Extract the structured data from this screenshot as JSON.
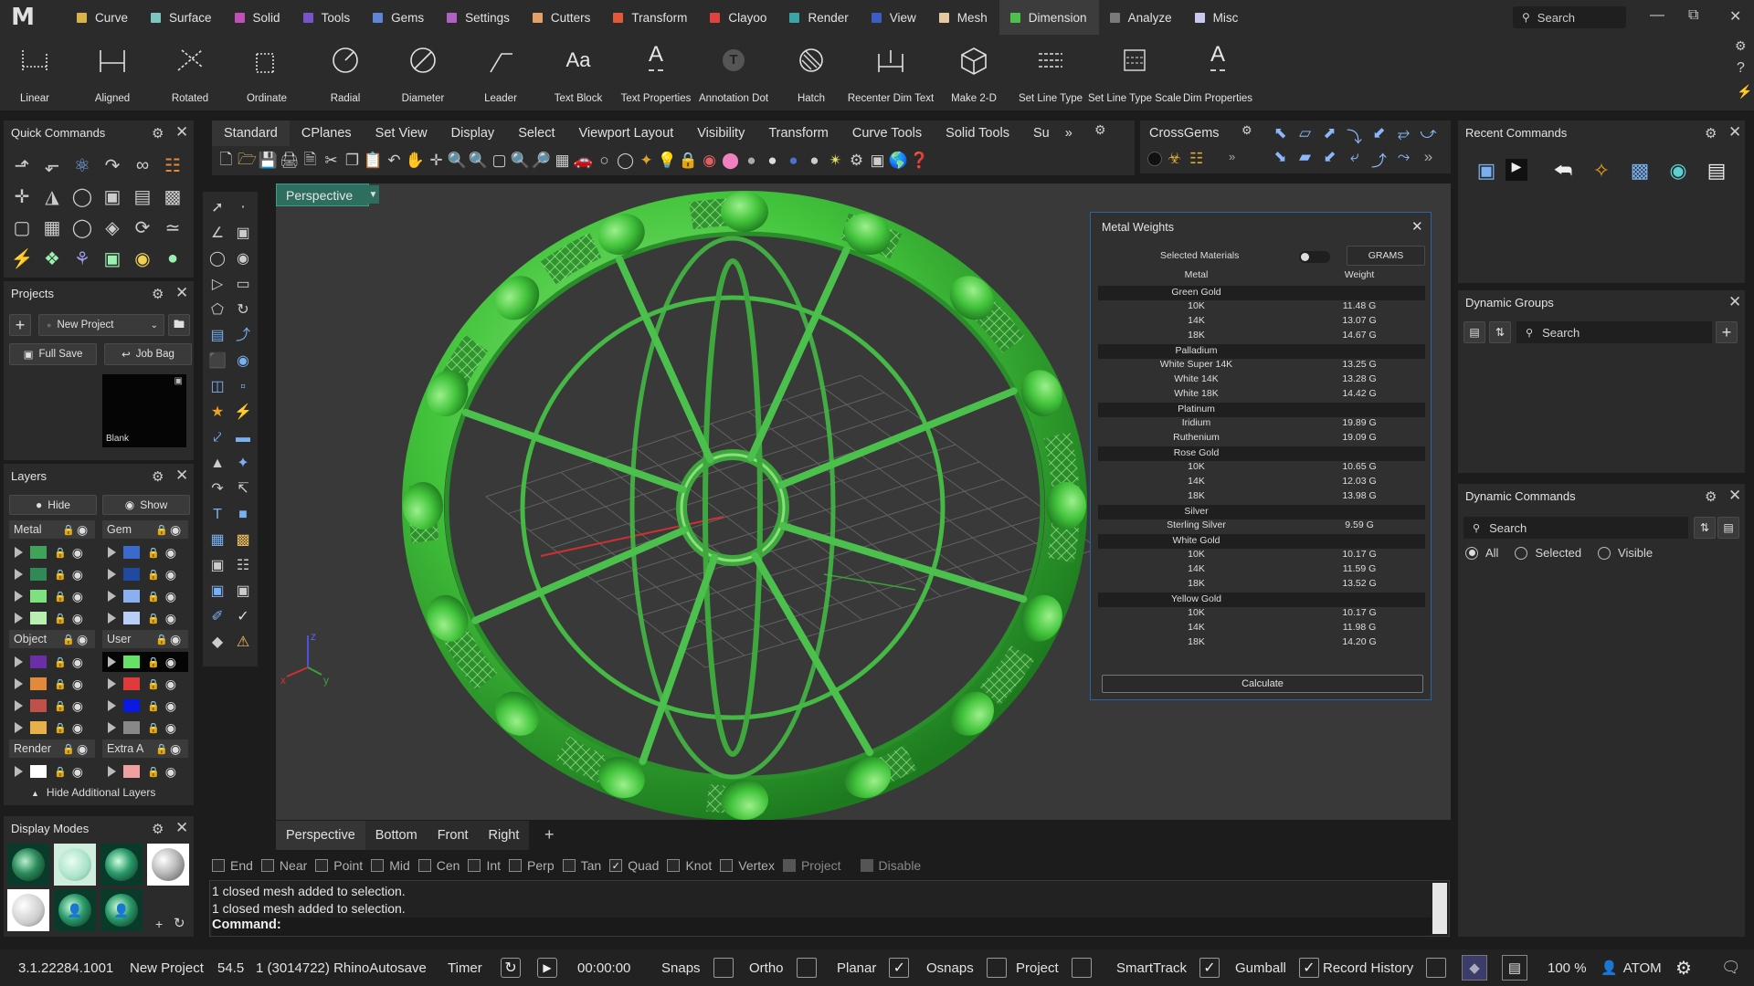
{
  "app": {
    "logo": "M"
  },
  "menu": [
    {
      "label": "Curve",
      "color": "#d9b24a"
    },
    {
      "label": "Surface",
      "color": "#7ec4c0"
    },
    {
      "label": "Solid",
      "color": "#c24fb8"
    },
    {
      "label": "Tools",
      "color": "#7a52c9"
    },
    {
      "label": "Gems",
      "color": "#5f86d6"
    },
    {
      "label": "Settings",
      "color": "#b160c4"
    },
    {
      "label": "Cutters",
      "color": "#e2a06a"
    },
    {
      "label": "Transform",
      "color": "#e05a3a"
    },
    {
      "label": "Clayoo",
      "color": "#e04141"
    },
    {
      "label": "Render",
      "color": "#3aa5a5"
    },
    {
      "label": "View",
      "color": "#3d5cc4"
    },
    {
      "label": "Mesh",
      "color": "#e6c9a0"
    },
    {
      "label": "Dimension",
      "color": "#4ec04e",
      "active": true
    },
    {
      "label": "Analyze",
      "color": "#7a7a7a"
    },
    {
      "label": "Misc",
      "color": "#c9c9f0"
    }
  ],
  "search_top": "Search",
  "ribbon": [
    {
      "label": "Linear",
      "icon": "linear-dim-icon"
    },
    {
      "label": "Aligned",
      "icon": "aligned-dim-icon"
    },
    {
      "label": "Rotated",
      "icon": "rotated-dim-icon"
    },
    {
      "label": "Ordinate",
      "icon": "ordinate-dim-icon"
    },
    {
      "label": "Radial",
      "icon": "radial-dim-icon"
    },
    {
      "label": "Diameter",
      "icon": "diameter-dim-icon"
    },
    {
      "label": "Leader",
      "icon": "leader-icon"
    },
    {
      "label": "Text Block",
      "icon": "text-block-icon",
      "glyph": "Aa"
    },
    {
      "label": "Text Properties",
      "icon": "text-properties-icon",
      "glyph": "A"
    },
    {
      "label": "Annotation Dot",
      "icon": "annotation-dot-icon",
      "glyph": "T"
    },
    {
      "label": "Hatch",
      "icon": "hatch-icon"
    },
    {
      "label": "Recenter Dim Text",
      "icon": "recenter-dim-text-icon"
    },
    {
      "label": "Make 2-D",
      "icon": "make-2d-icon"
    },
    {
      "label": "Set Line Type",
      "icon": "set-line-type-icon"
    },
    {
      "label": "Set Line Type Scale",
      "icon": "set-line-type-scale-icon"
    },
    {
      "label": "Dim Properties",
      "icon": "dim-properties-icon",
      "glyph": "A"
    }
  ],
  "quick_commands": {
    "title": "Quick Commands"
  },
  "projects": {
    "title": "Projects",
    "dropdown": "New Project",
    "full_save": "Full Save",
    "job_bag": "Job Bag",
    "thumb_label": "Blank"
  },
  "layers": {
    "title": "Layers",
    "hide": "Hide",
    "show": "Show",
    "groups_left": [
      {
        "name": "Metal",
        "colors": [
          "#3fa35a",
          "#2f8a55",
          "#7fe07f",
          "#b9f0b0"
        ]
      },
      {
        "name": "Object",
        "colors": [
          "#6a2fa8",
          "#e38a3a",
          "#c0504a",
          "#e8b04a"
        ]
      },
      {
        "name": "Render",
        "colors": [
          "#ffffff"
        ]
      }
    ],
    "groups_right": [
      {
        "name": "Gem",
        "colors": [
          "#3a6acc",
          "#1f4aa0",
          "#8ab0f0",
          "#b8d0f8"
        ]
      },
      {
        "name": "User",
        "colors": [
          "#66e066",
          "#e03a3a",
          "#0a1ae0",
          "#888888"
        ]
      },
      {
        "name": "Extra A",
        "colors": [
          "#f0a0a0"
        ]
      }
    ],
    "hide_additional": "Hide Additional Layers"
  },
  "display_modes": {
    "title": "Display Modes"
  },
  "toolbar_tabs": [
    "Standard",
    "CPlanes",
    "Set View",
    "Display",
    "Select",
    "Viewport Layout",
    "Visibility",
    "Transform",
    "Curve Tools",
    "Solid Tools",
    "Su"
  ],
  "crossgems_tab": "CrossGems",
  "viewport": {
    "label": "Perspective"
  },
  "viewport_tabs": [
    "Perspective",
    "Bottom",
    "Front",
    "Right"
  ],
  "metal_weights": {
    "title": "Metal Weights",
    "selected_materials": "Selected Materials",
    "unit_button": "GRAMS",
    "col_metal": "Metal",
    "col_weight": "Weight",
    "groups": [
      {
        "name": "Green Gold",
        "rows": [
          [
            "10K",
            "11.48 G"
          ],
          [
            "14K",
            "13.07 G"
          ],
          [
            "18K",
            "14.67 G"
          ]
        ]
      },
      {
        "name": "Palladium",
        "rows": [
          [
            "White Super 14K",
            "13.25 G"
          ],
          [
            "White 14K",
            "13.28 G"
          ],
          [
            "White 18K",
            "14.42 G"
          ]
        ]
      },
      {
        "name": "Platinum",
        "rows": [
          [
            "Iridium",
            "19.89 G"
          ],
          [
            "Ruthenium",
            "19.09 G"
          ]
        ]
      },
      {
        "name": "Rose Gold",
        "rows": [
          [
            "10K",
            "10.65 G"
          ],
          [
            "14K",
            "12.03 G"
          ],
          [
            "18K",
            "13.98 G"
          ]
        ]
      },
      {
        "name": "Silver",
        "rows": [
          [
            "Sterling Silver",
            "9.59 G"
          ]
        ]
      },
      {
        "name": "White Gold",
        "rows": [
          [
            "10K",
            "10.17 G"
          ],
          [
            "14K",
            "11.59 G"
          ],
          [
            "18K",
            "13.52 G"
          ]
        ]
      },
      {
        "name": "Yellow Gold",
        "rows": [
          [
            "10K",
            "10.17 G"
          ],
          [
            "14K",
            "11.98 G"
          ],
          [
            "18K",
            "14.20 G"
          ]
        ]
      }
    ],
    "calculate": "Calculate"
  },
  "snaps": [
    {
      "label": "End",
      "checked": false
    },
    {
      "label": "Near",
      "checked": false
    },
    {
      "label": "Point",
      "checked": false
    },
    {
      "label": "Mid",
      "checked": false
    },
    {
      "label": "Cen",
      "checked": false
    },
    {
      "label": "Int",
      "checked": false
    },
    {
      "label": "Perp",
      "checked": false
    },
    {
      "label": "Tan",
      "checked": false
    },
    {
      "label": "Quad",
      "checked": true
    },
    {
      "label": "Knot",
      "checked": false
    },
    {
      "label": "Vertex",
      "checked": false
    },
    {
      "label": "Project",
      "checked": false,
      "disabled": true
    },
    {
      "label": "Disable",
      "checked": false,
      "disabled": true
    }
  ],
  "command": {
    "history": [
      "1 closed mesh added to selection.",
      "1 closed mesh added to selection."
    ],
    "prompt": "Command:"
  },
  "recent_commands": {
    "title": "Recent Commands"
  },
  "dynamic_groups": {
    "title": "Dynamic Groups",
    "search": "Search"
  },
  "dynamic_commands": {
    "title": "Dynamic Commands",
    "search": "Search",
    "radios": [
      {
        "label": "All",
        "checked": true
      },
      {
        "label": "Selected",
        "checked": false
      },
      {
        "label": "Visible",
        "checked": false
      }
    ]
  },
  "status": {
    "version": "3.1.22284.1001",
    "project": "New Project",
    "value": "54.5",
    "autosave": "1 (3014722) RhinoAutosave",
    "timer": "Timer",
    "time": "00:00:00",
    "toggles": [
      {
        "label": "Snaps",
        "checked": false
      },
      {
        "label": "Ortho",
        "checked": false
      },
      {
        "label": "Planar",
        "checked": true
      },
      {
        "label": "Osnaps",
        "checked": false
      },
      {
        "label": "Project",
        "checked": false
      },
      {
        "label": "SmartTrack",
        "checked": true
      },
      {
        "label": "Gumball",
        "checked": true
      },
      {
        "label": "Record History",
        "checked": false
      }
    ],
    "zoom": "100 %",
    "user": "ATOM"
  }
}
